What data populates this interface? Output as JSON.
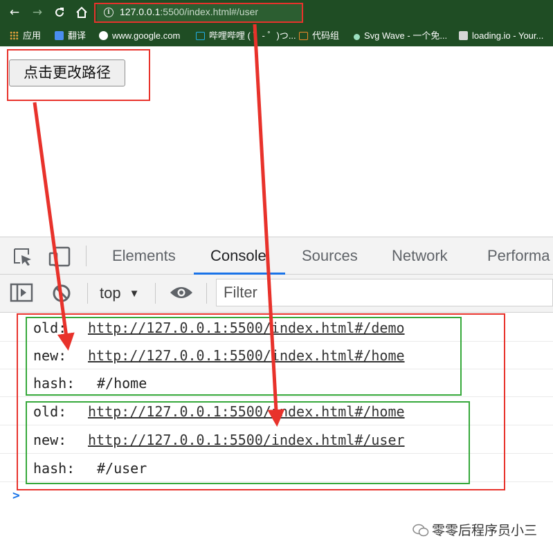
{
  "browser": {
    "url_host": "127.0.0.1",
    "url_rest": ":5500/index.html#/user",
    "bookmarks": [
      {
        "label": "应用",
        "color": "#e8a33d"
      },
      {
        "label": "翻译",
        "color": "#4a8ef0"
      },
      {
        "label": "www.google.com",
        "color": "#ffffff"
      },
      {
        "label": "哔哩哔哩 ( ゜- ゜)つ...",
        "color": "#23ade5"
      },
      {
        "label": "代码组",
        "color": "#f0892b"
      },
      {
        "label": "Svg Wave - 一个免...",
        "color": "#9be0c0"
      },
      {
        "label": "loading.io - Your...",
        "color": "#d6d6d6"
      }
    ]
  },
  "page": {
    "button_label": "点击更改路径"
  },
  "devtools": {
    "tabs": [
      "Elements",
      "Console",
      "Sources",
      "Network",
      "Performa"
    ],
    "active_tab": "Console",
    "context": "top",
    "filter_placeholder": "Filter"
  },
  "console": {
    "groups": [
      {
        "old_label": "old:",
        "old_url": "http://127.0.0.1:5500/index.html#/demo",
        "new_label": "new:",
        "new_url": "http://127.0.0.1:5500/index.html#/home",
        "hash_label": "hash:",
        "hash": "#/home"
      },
      {
        "old_label": "old:",
        "old_url": "http://127.0.0.1:5500/index.html#/home",
        "new_label": "new:",
        "new_url": "http://127.0.0.1:5500/index.html#/user",
        "hash_label": "hash:",
        "hash": "#/user"
      }
    ],
    "prompt": ">"
  },
  "watermark": "零零后程序员小三",
  "colors": {
    "annotation_red": "#e8322b",
    "annotation_green": "#35a83a",
    "chrome_green": "#1f4d24",
    "devtools_accent": "#1a73e8"
  }
}
